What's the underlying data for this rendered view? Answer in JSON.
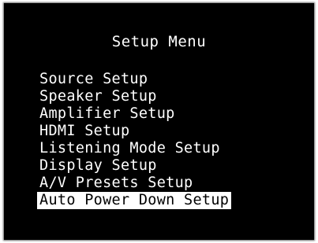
{
  "title": "Setup Menu",
  "menu": {
    "items": [
      {
        "label": "Source Setup",
        "selected": false
      },
      {
        "label": "Speaker Setup",
        "selected": false
      },
      {
        "label": "Amplifier Setup",
        "selected": false
      },
      {
        "label": "HDMI Setup",
        "selected": false
      },
      {
        "label": "Listening Mode Setup",
        "selected": false
      },
      {
        "label": "Display Setup",
        "selected": false
      },
      {
        "label": "A/V Presets Setup",
        "selected": false
      },
      {
        "label": "Auto Power Down Setup",
        "selected": true
      }
    ]
  },
  "colors": {
    "background": "#000000",
    "text": "#ffffff",
    "highlight_background": "#ffffff",
    "highlight_text": "#000000"
  }
}
